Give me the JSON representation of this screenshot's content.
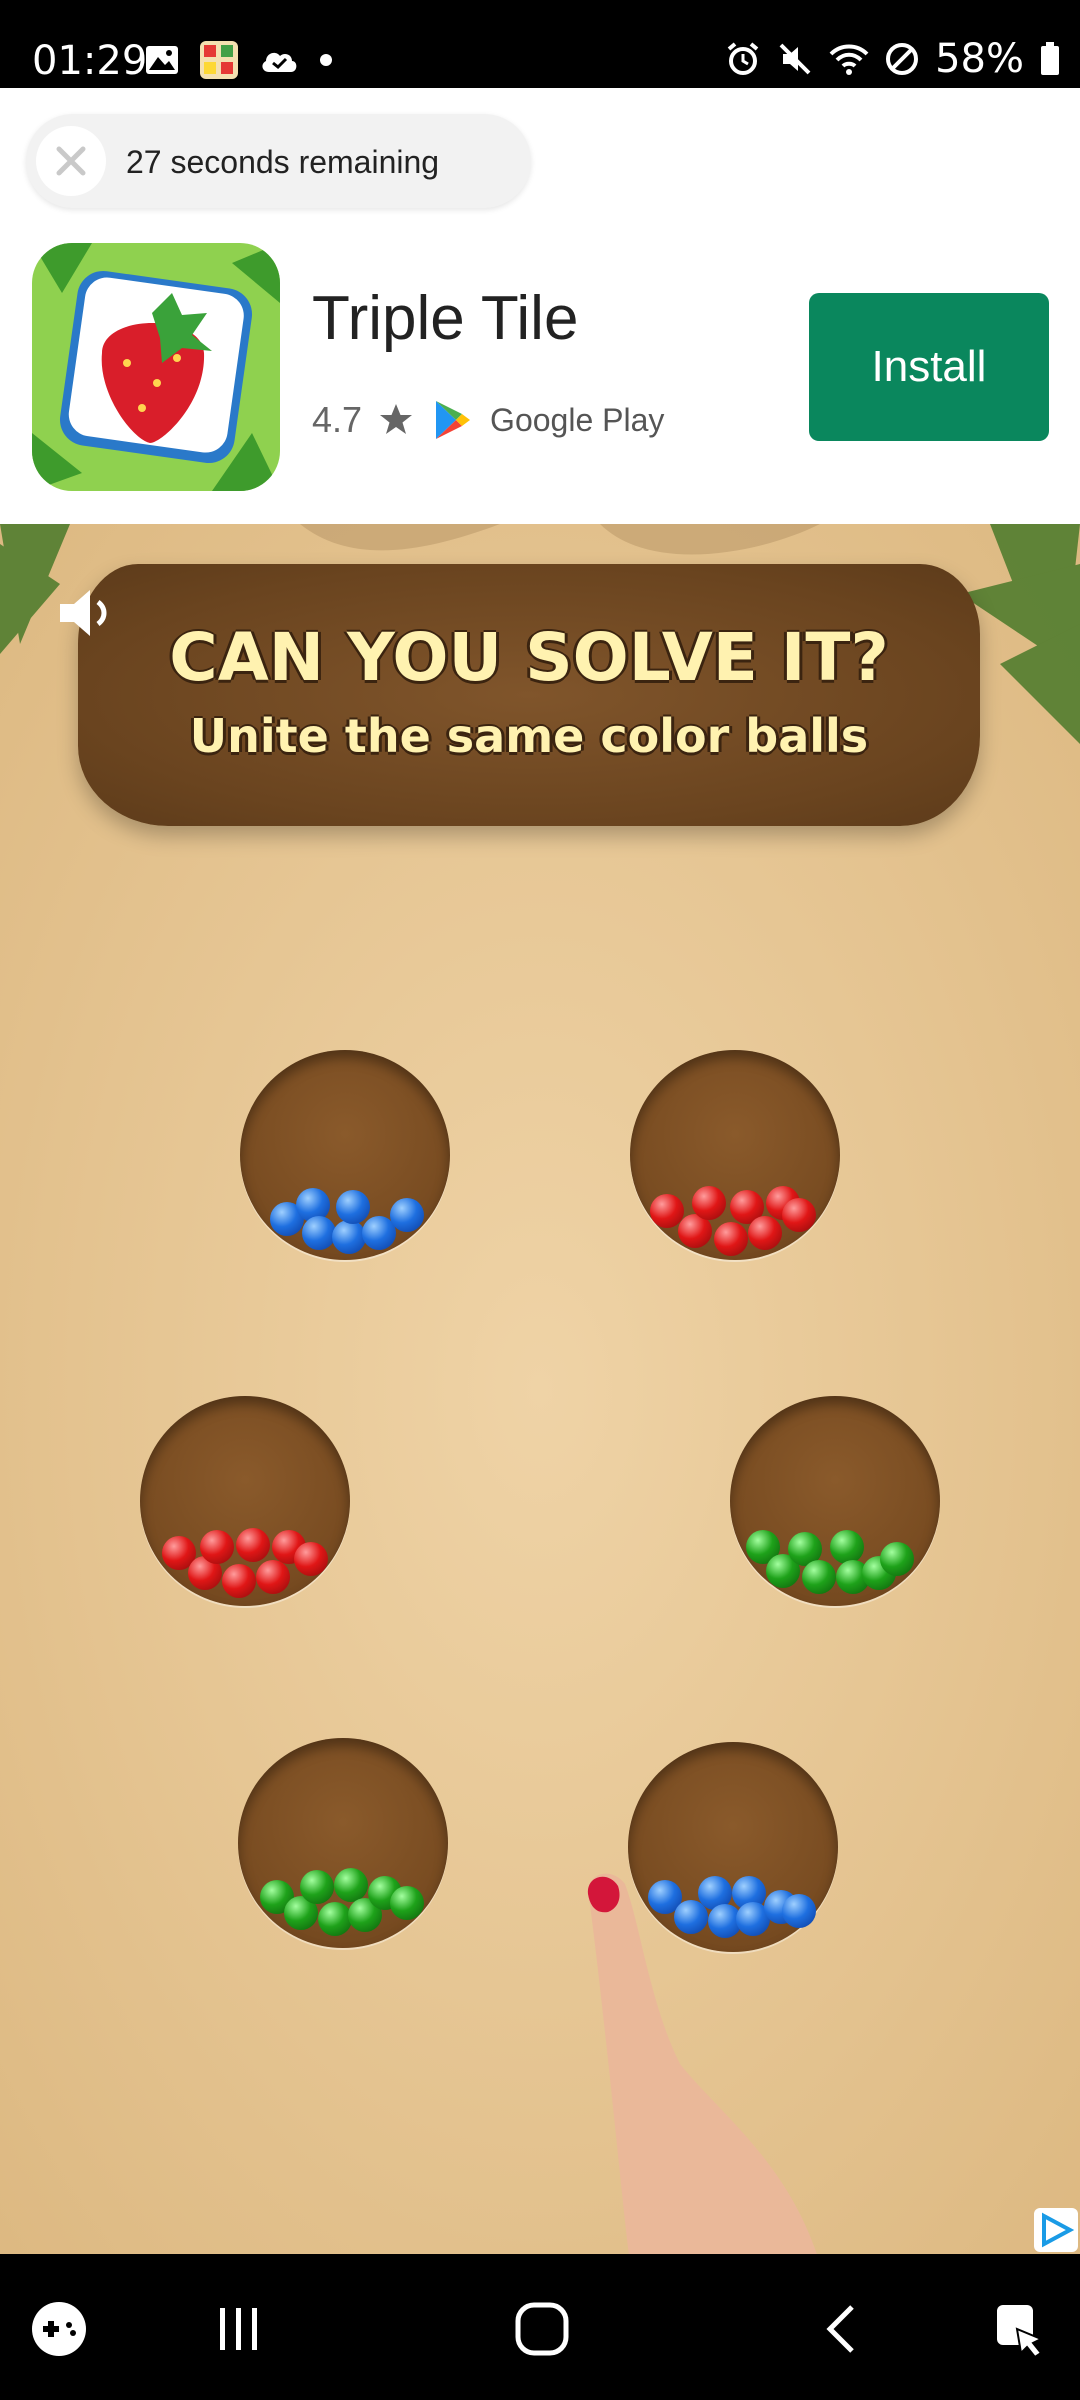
{
  "status_bar": {
    "time": "01:29",
    "battery": "58%"
  },
  "ad": {
    "countdown_text": "27 seconds remaining",
    "app_name": "Triple Tile",
    "rating": "4.7",
    "store": "Google Play",
    "install_label": "Install"
  },
  "game": {
    "title": "CAN YOU SOLVE IT?",
    "subtitle": "Unite the same color balls",
    "holes": [
      {
        "color": "blue",
        "balls": 7
      },
      {
        "color": "red",
        "balls": 8
      },
      {
        "color": "red",
        "balls": 8
      },
      {
        "color": "green",
        "balls": 8
      },
      {
        "color": "green",
        "balls": 8
      },
      {
        "color": "blue",
        "balls": 8
      }
    ]
  },
  "colors": {
    "install": "#0a875d",
    "sand": "#e7c89a",
    "banner": "#6a441f",
    "banner_text": "#fff2b0"
  }
}
